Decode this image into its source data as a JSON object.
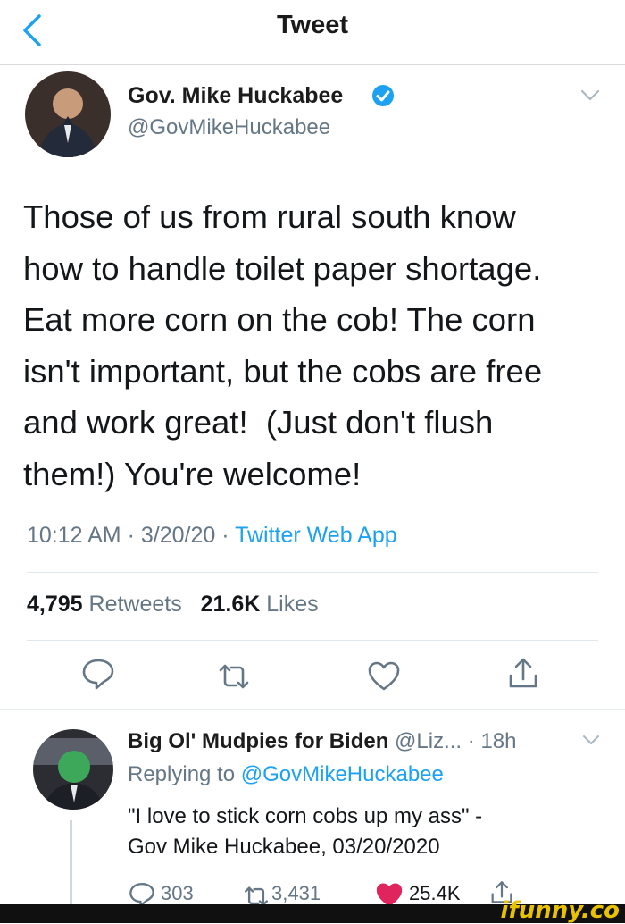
{
  "header": {
    "title": "Tweet"
  },
  "tweet": {
    "author_name": "Gov. Mike Huckabee",
    "author_handle": "@GovMikeHuckabee",
    "text_lines": [
      "Those of us from rural south know",
      "how to handle toilet paper shortage.",
      "Eat more corn on the cob! The corn",
      "isn't important, but the cobs are free",
      "and work great!  (Just don't flush",
      "them!) You're welcome!"
    ],
    "time": "10:12 AM",
    "dot1": "·",
    "date": "3/20/20",
    "dot2": "·",
    "app": "Twitter Web App",
    "retweets_count": "4,795",
    "retweets_label": "Retweets",
    "likes_count": "21.6K",
    "likes_label": "Likes"
  },
  "reply": {
    "author_name": "Big Ol' Mudpies for Biden",
    "author_handle": "@Liz...",
    "dot": "·",
    "age": "18h",
    "replying_prefix": "Replying to",
    "replying_handle": "@GovMikeHuckabee",
    "text_line1": "\"I love to stick corn cobs up my ass\" -",
    "text_line2": "Gov Mike Huckabee, 03/20/2020",
    "replies": "303",
    "retweets": "3,431",
    "likes": "25.4K"
  },
  "watermark": "ifunny.co",
  "colors": {
    "accent": "#1da1f2",
    "like": "#e0245e",
    "muted": "#657786"
  },
  "icons": [
    "back-chevron-icon",
    "verified-badge-icon",
    "chevron-down-icon",
    "reply-icon",
    "retweet-icon",
    "like-icon",
    "share-icon"
  ]
}
